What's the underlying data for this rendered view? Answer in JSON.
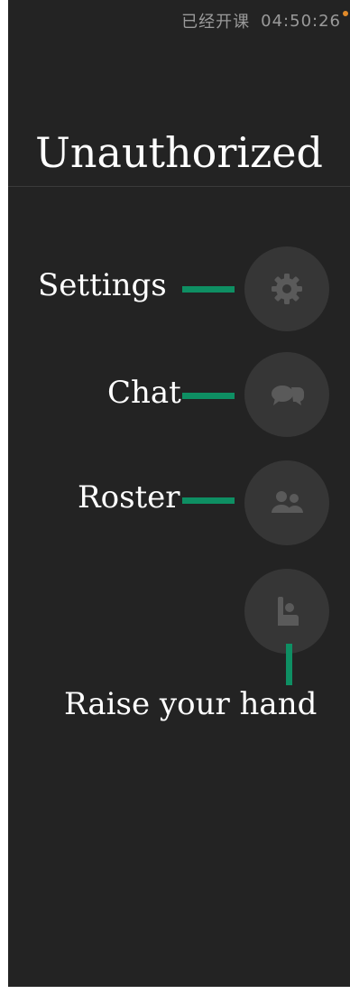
{
  "status": {
    "class_state": "已经开课",
    "elapsed": "04:50:26"
  },
  "title": "Unauthorized",
  "annotations": {
    "settings": "Settings",
    "chat": "Chat",
    "roster": "Roster",
    "raise_hand": "Raise your hand"
  },
  "icons": {
    "settings": "gear-icon",
    "chat": "chat-bubbles-icon",
    "roster": "people-icon",
    "raise_hand": "raised-hand-icon"
  },
  "colors": {
    "background": "#232323",
    "button": "#363636",
    "icon": "#5a5a5a",
    "annotation_line": "#0e8f63",
    "status_dot": "#e08a2a"
  }
}
